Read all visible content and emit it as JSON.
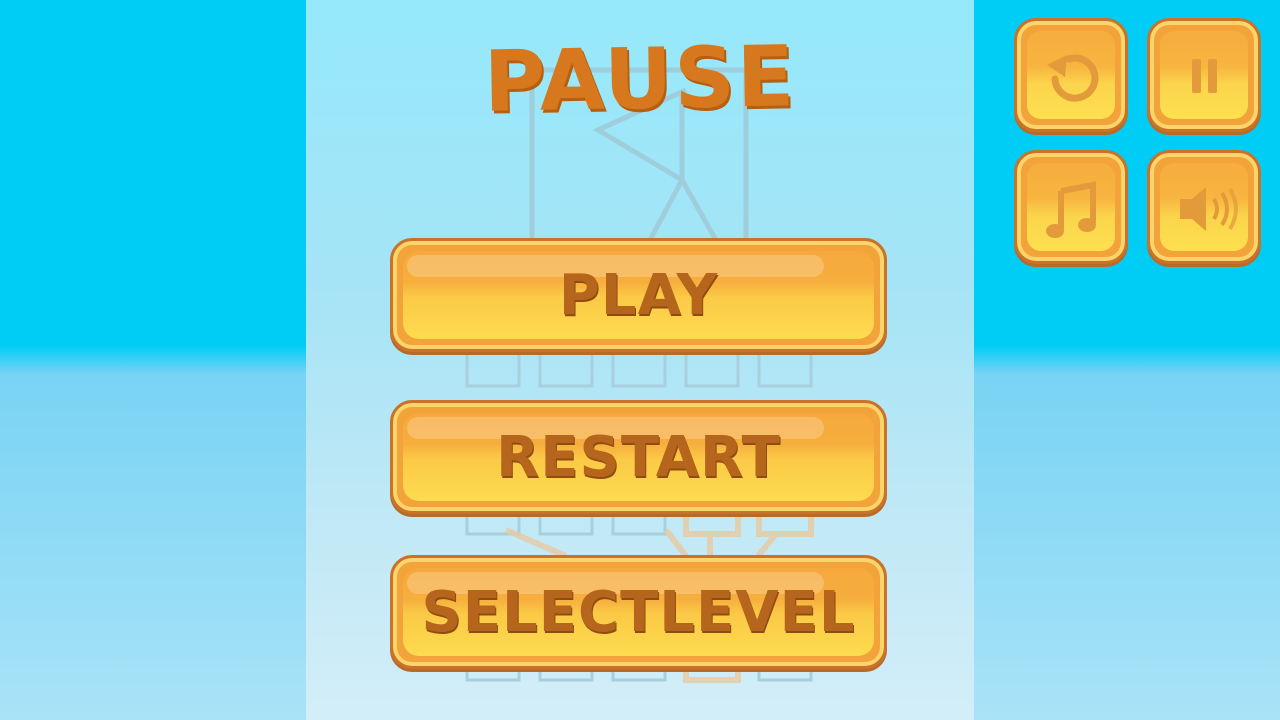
{
  "pause_menu": {
    "title": "PAUSE",
    "buttons": {
      "play": "PLAY",
      "restart": "RESTART",
      "select_level": "SELECTLEVEL"
    }
  },
  "top_controls": [
    {
      "id": "restart",
      "icon": "restart-icon"
    },
    {
      "id": "pause",
      "icon": "pause-icon"
    },
    {
      "id": "music",
      "icon": "music-icon"
    },
    {
      "id": "sound",
      "icon": "speaker-icon"
    }
  ],
  "colors": {
    "sky": "#00cdf6",
    "button_orange": "#f2a43a",
    "button_yellow": "#fddc4e",
    "text_brown": "#b5651c",
    "title_orange": "#d8781e"
  }
}
